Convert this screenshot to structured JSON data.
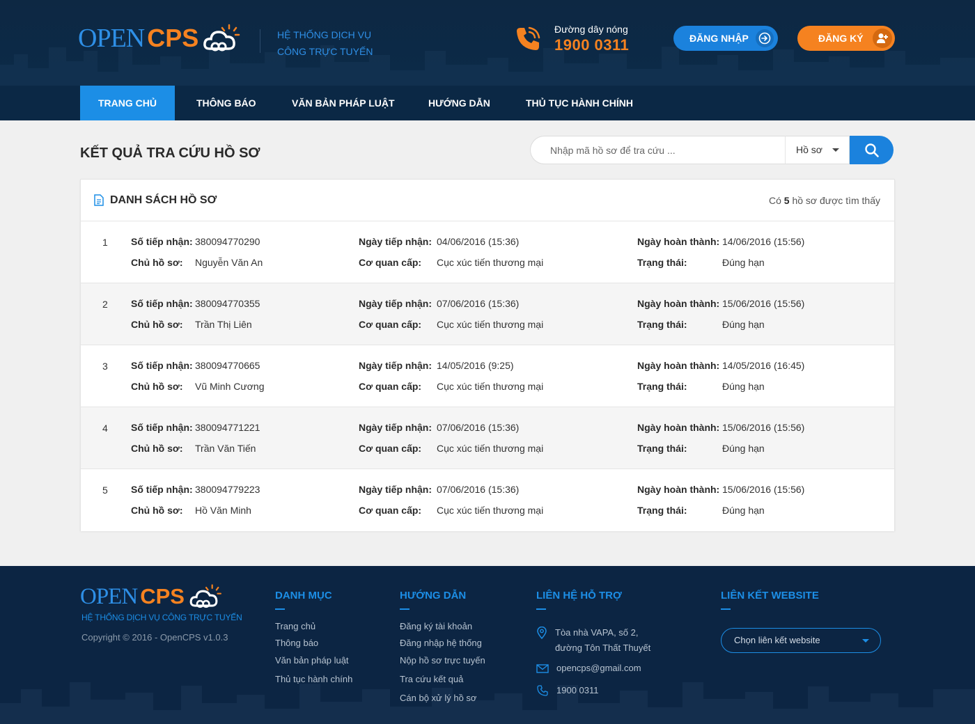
{
  "colors": {
    "brand_blue": "#1c8ee6",
    "brand_orange": "#f58220",
    "header_bg": "#0d2843",
    "footer_bg": "#0c2543"
  },
  "header": {
    "logo_open": "OPEN",
    "logo_cps": "CPS",
    "tagline_line1": "HỆ THỐNG DỊCH VỤ",
    "tagline_line2": "CÔNG TRỰC TUYẾN",
    "hotline_label": "Đường dây nóng",
    "hotline_number": "1900 0311",
    "login_label": "ĐĂNG NHẬP",
    "register_label": "ĐĂNG KÝ"
  },
  "nav": {
    "items": [
      {
        "label": "TRANG CHỦ",
        "active": true
      },
      {
        "label": "THÔNG BÁO",
        "active": false
      },
      {
        "label": "VĂN BẢN PHÁP LUẬT",
        "active": false
      },
      {
        "label": "HƯỚNG DẪN",
        "active": false
      },
      {
        "label": "THỦ TỤC HÀNH CHÍNH",
        "active": false
      }
    ]
  },
  "main": {
    "title": "KẾT QUẢ TRA CỨU HỒ SƠ",
    "search": {
      "placeholder": "Nhập mã hồ sơ để tra cứu ...",
      "value": "",
      "type_selected": "Hồ sơ"
    },
    "panel": {
      "title": "DANH SÁCH HỒ SƠ",
      "count_prefix": "Có",
      "count_value": "5",
      "count_suffix": "hồ sơ được tìm thấy"
    },
    "labels": {
      "receipt_no": "Số tiếp nhận:",
      "owner": "Chủ hồ sơ:",
      "received_date": "Ngày tiếp nhận:",
      "agency": "Cơ quan cấp:",
      "completed_date": "Ngày hoàn thành:",
      "status": "Trạng thái:"
    },
    "records": [
      {
        "index": "1",
        "receipt_no": "380094770290",
        "owner": "Nguyễn Văn An",
        "received_date": "04/06/2016 (15:36)",
        "agency": "Cục xúc tiến thương mại",
        "completed_date": "14/06/2016 (15:56)",
        "status": "Đúng hạn"
      },
      {
        "index": "2",
        "receipt_no": "380094770355",
        "owner": "Trần Thị Liên",
        "received_date": "07/06/2016 (15:36)",
        "agency": "Cục xúc tiến thương mại",
        "completed_date": "15/06/2016 (15:56)",
        "status": "Đúng hạn"
      },
      {
        "index": "3",
        "receipt_no": "380094770665",
        "owner": "Vũ Minh Cương",
        "received_date": "14/05/2016 (9:25)",
        "agency": "Cục xúc tiến thương mại",
        "completed_date": "14/05/2016 (16:45)",
        "status": "Đúng hạn"
      },
      {
        "index": "4",
        "receipt_no": "380094771221",
        "owner": "Trần Văn Tiến",
        "received_date": "07/06/2016 (15:36)",
        "agency": "Cục xúc tiến thương mại",
        "completed_date": "15/06/2016 (15:56)",
        "status": "Đúng hạn"
      },
      {
        "index": "5",
        "receipt_no": "380094779223",
        "owner": "Hồ Văn Minh",
        "received_date": "07/06/2016 (15:36)",
        "agency": "Cục xúc tiến thương mại",
        "completed_date": "15/06/2016 (15:56)",
        "status": "Đúng hạn"
      }
    ]
  },
  "footer": {
    "logo_open": "OPEN",
    "logo_cps": "CPS",
    "tagline": "HỆ THỐNG DỊCH VỤ CÔNG TRỰC TUYẾN",
    "copyright": "Copyright © 2016 - OpenCPS v1.0.3",
    "categories": {
      "title": "DANH MỤC",
      "links": [
        "Trang chủ",
        "Thông báo",
        "Văn bản pháp luật",
        "Thủ tục hành chính"
      ]
    },
    "guides": {
      "title": "HƯỚNG DẪN",
      "links": [
        "Đăng ký tài khoản",
        "Đăng nhập hệ thống",
        "Nộp hồ sơ trực tuyến",
        "Tra cứu kết quả",
        "Cán bộ xử lý hồ sơ"
      ]
    },
    "support": {
      "title": "LIÊN HỆ HỖ TRỢ",
      "address_line1": "Tòa nhà VAPA, số 2,",
      "address_line2": "đường Tôn Thất Thuyết",
      "email": "opencps@gmail.com",
      "phone": "1900 0311"
    },
    "links_section": {
      "title": "LIÊN KẾT WEBSITE",
      "select_placeholder": "Chọn liên kết website"
    }
  }
}
